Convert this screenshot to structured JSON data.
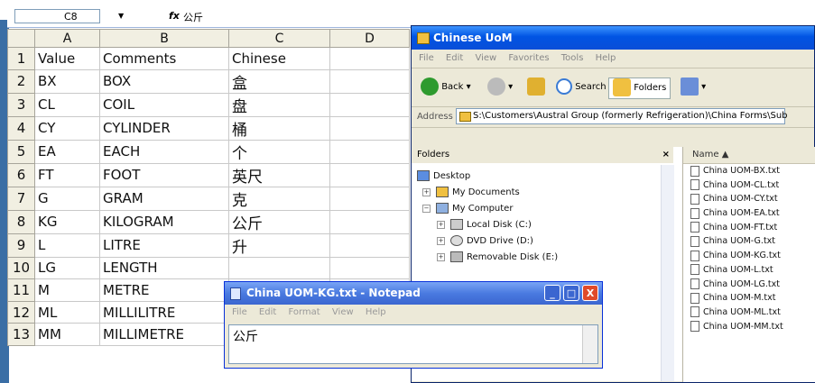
{
  "excel": {
    "name_box": "C8",
    "fx_label": "fx",
    "formula_value": "公斤",
    "columns": [
      "A",
      "B",
      "C",
      "D"
    ],
    "rows": [
      {
        "num": "1",
        "a": "Value",
        "b": "Comments",
        "c": "Chinese"
      },
      {
        "num": "2",
        "a": "BX",
        "b": "BOX",
        "c": "盒"
      },
      {
        "num": "3",
        "a": "CL",
        "b": "COIL",
        "c": "盘"
      },
      {
        "num": "4",
        "a": "CY",
        "b": "CYLINDER",
        "c": "桶"
      },
      {
        "num": "5",
        "a": "EA",
        "b": "EACH",
        "c": "个"
      },
      {
        "num": "6",
        "a": "FT",
        "b": "FOOT",
        "c": "英尺"
      },
      {
        "num": "7",
        "a": "G",
        "b": "GRAM",
        "c": "克"
      },
      {
        "num": "8",
        "a": "KG",
        "b": "KILOGRAM",
        "c": "公斤"
      },
      {
        "num": "9",
        "a": "L",
        "b": "LITRE",
        "c": "升"
      },
      {
        "num": "10",
        "a": "LG",
        "b": "LENGTH",
        "c": ""
      },
      {
        "num": "11",
        "a": "M",
        "b": "METRE",
        "c": ""
      },
      {
        "num": "12",
        "a": "ML",
        "b": "MILLILITRE",
        "c": ""
      },
      {
        "num": "13",
        "a": "MM",
        "b": "MILLIMETRE",
        "c": ""
      }
    ]
  },
  "explorer": {
    "title": "Chinese UoM",
    "menu": [
      "File",
      "Edit",
      "View",
      "Favorites",
      "Tools",
      "Help"
    ],
    "back_label": "Back",
    "search_label": "Search",
    "folders_label": "Folders",
    "address_label": "Address",
    "address_value": "S:\\Customers\\Austral Group (formerly Refrigeration)\\China Forms\\Sub",
    "folders_header": "Folders",
    "close_glyph": "×",
    "name_header": "Name",
    "tree": [
      {
        "label": "Desktop"
      },
      {
        "label": "My Documents"
      },
      {
        "label": "My Computer"
      },
      {
        "label": "Local Disk (C:)"
      },
      {
        "label": "DVD Drive (D:)"
      },
      {
        "label": "Removable Disk (E:)"
      }
    ],
    "files": [
      "China UOM-BX.txt",
      "China UOM-CL.txt",
      "China UOM-CY.txt",
      "China UOM-EA.txt",
      "China UOM-FT.txt",
      "China UOM-G.txt",
      "China UOM-KG.txt",
      "China UOM-L.txt",
      "China UOM-LG.txt",
      "China UOM-M.txt",
      "China UOM-ML.txt",
      "China UOM-MM.txt"
    ]
  },
  "notepad": {
    "title": "China UOM-KG.txt - Notepad",
    "menu": [
      "File",
      "Edit",
      "Format",
      "View",
      "Help"
    ],
    "content": "公斤",
    "min_glyph": "_",
    "max_glyph": "□",
    "close_glyph": "X"
  },
  "colors": {
    "xp_blue": "#0054e3",
    "header_bg": "#f1efe2",
    "close_red": "#e04a2a"
  }
}
